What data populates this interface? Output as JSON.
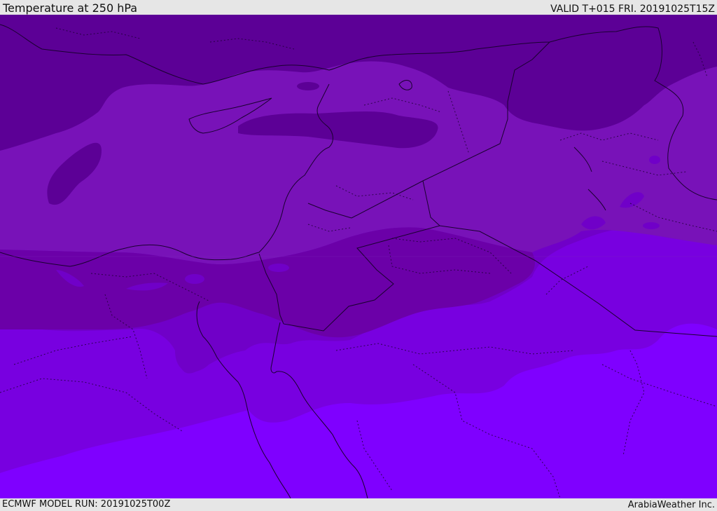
{
  "header": {
    "title": "Temperature at 250 hPa",
    "valid_time": "VALID T+015 FRI. 20191025T15Z"
  },
  "footer": {
    "model_run": "ECMWF MODEL RUN: 20191025T00Z",
    "credit": "ArabiaWeather Inc."
  },
  "map": {
    "variable": "temperature",
    "pressure_level_hpa": 250,
    "color_bands": [
      "#5c0096",
      "#6b00a8",
      "#7812b8",
      "#7000c8",
      "#7800e0",
      "#7f00ff"
    ],
    "border_color": "#1a0030"
  }
}
